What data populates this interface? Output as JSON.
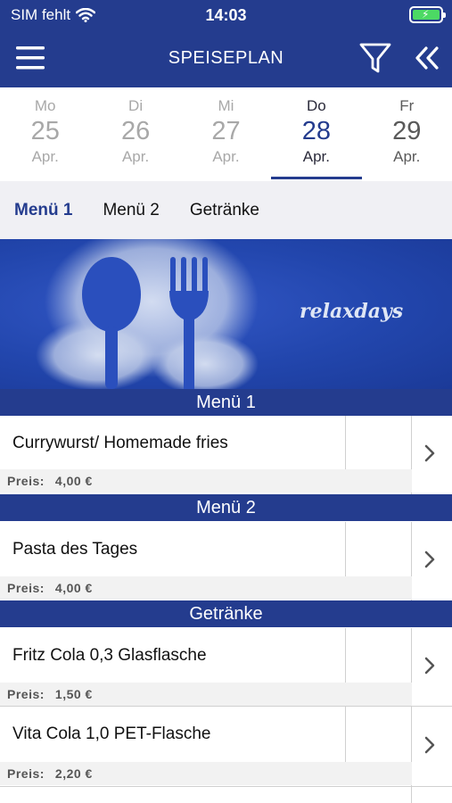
{
  "status": {
    "carrier": "SIM fehlt",
    "time": "14:03"
  },
  "header": {
    "title": "SPEISEPLAN"
  },
  "days": [
    {
      "weekday": "Mo",
      "day": "25",
      "month": "Apr."
    },
    {
      "weekday": "Di",
      "day": "26",
      "month": "Apr."
    },
    {
      "weekday": "Mi",
      "day": "27",
      "month": "Apr."
    },
    {
      "weekday": "Do",
      "day": "28",
      "month": "Apr."
    },
    {
      "weekday": "Fr",
      "day": "29",
      "month": "Apr."
    }
  ],
  "tabs": [
    {
      "label": "Menü 1"
    },
    {
      "label": "Menü 2"
    },
    {
      "label": "Getränke"
    }
  ],
  "banner": {
    "brand": "relaxdays"
  },
  "sections": [
    {
      "title": "Menü 1"
    },
    {
      "title": "Menü 2"
    },
    {
      "title": "Getränke"
    }
  ],
  "items": [
    {
      "name": "Currywurst/ Homemade fries",
      "price_label": "Preis:",
      "price": "4,00 €"
    },
    {
      "name": "Pasta des Tages",
      "price_label": "Preis:",
      "price": "4,00 €"
    },
    {
      "name": "Fritz Cola 0,3 Glasflasche",
      "price_label": "Preis:",
      "price": "1,50 €"
    },
    {
      "name": "Vita Cola 1,0 PET-Flasche",
      "price_label": "Preis:",
      "price": "2,20 €"
    }
  ],
  "colors": {
    "primary": "#243c8e",
    "battery": "#4cd964"
  }
}
